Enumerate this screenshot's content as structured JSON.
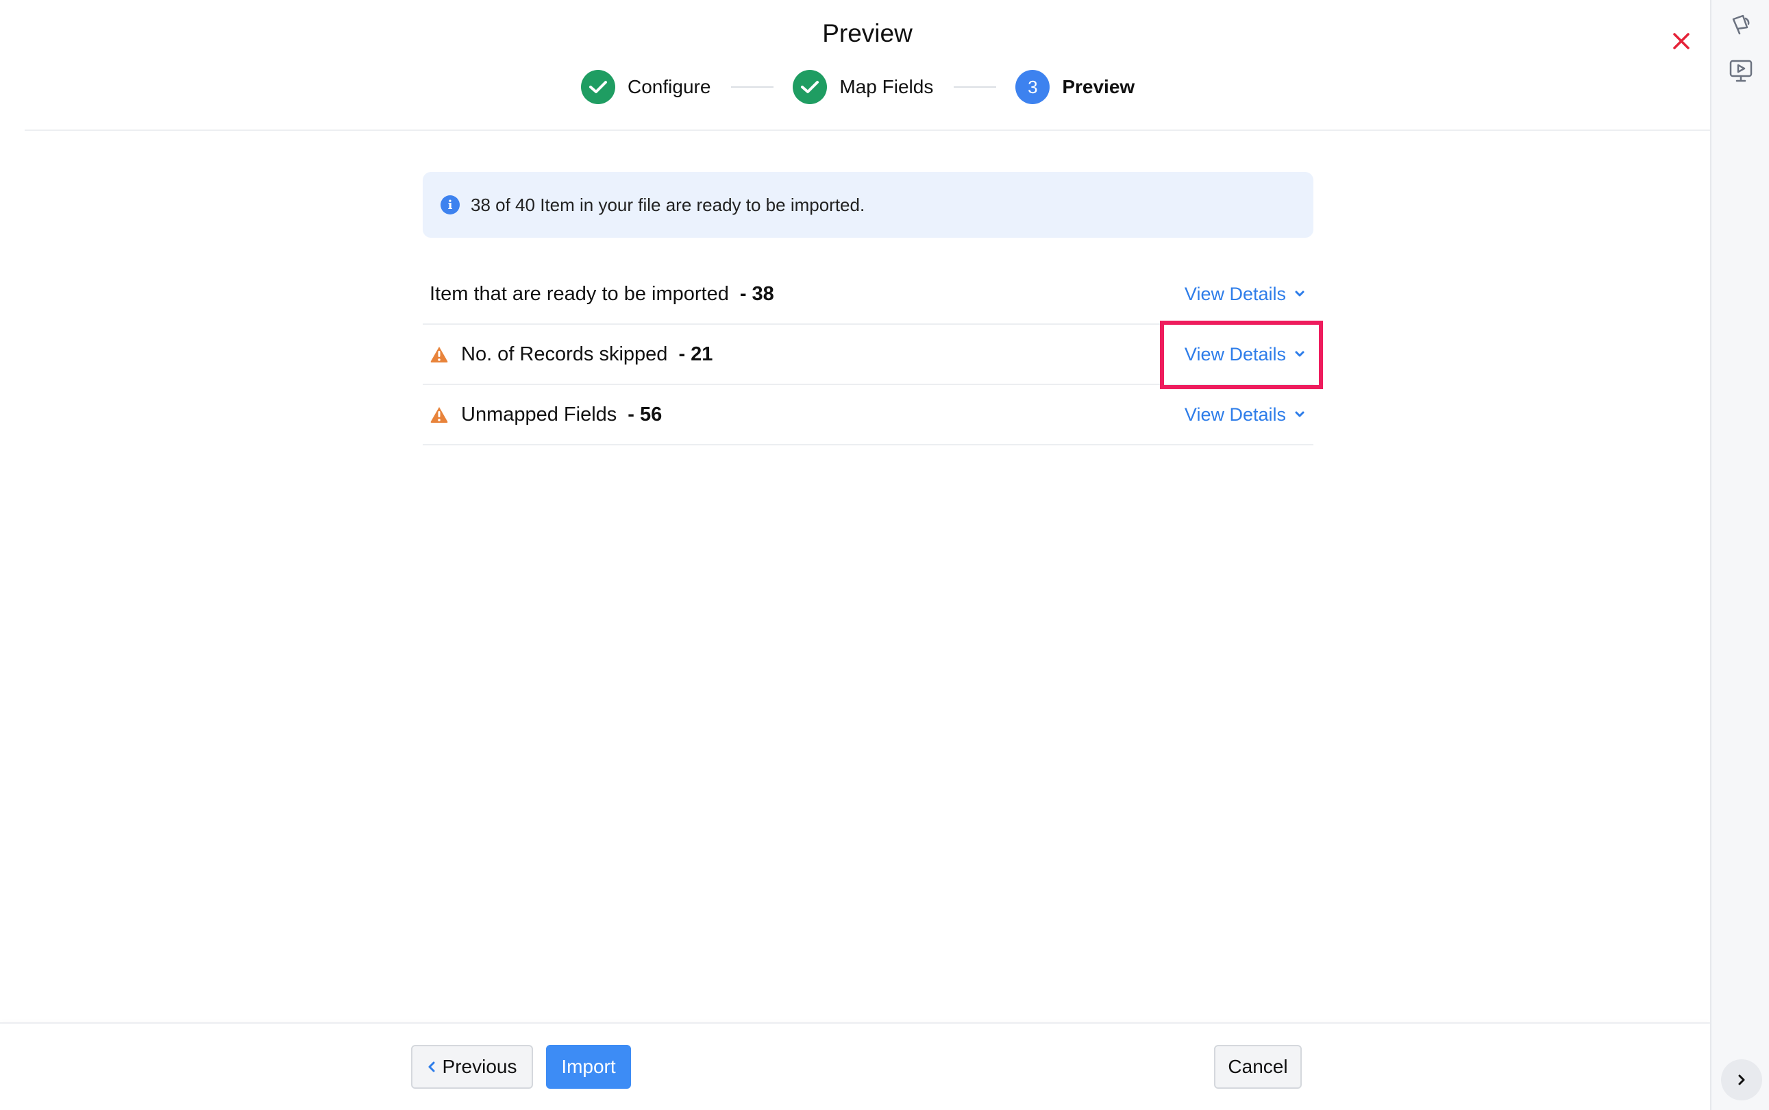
{
  "header": {
    "title": "Preview"
  },
  "stepper": {
    "steps": [
      {
        "label": "Configure",
        "state": "done"
      },
      {
        "label": "Map Fields",
        "state": "done"
      },
      {
        "label": "Preview",
        "state": "active",
        "number": "3"
      }
    ]
  },
  "info_banner": {
    "text": "38 of 40 Item in your file are ready to be imported."
  },
  "summary_rows": [
    {
      "label": "Item that are ready to be imported",
      "count": "- 38",
      "action": "View Details",
      "warning": false
    },
    {
      "label": "No. of Records skipped",
      "count": "- 21",
      "action": "View Details",
      "warning": true
    },
    {
      "label": "Unmapped Fields",
      "count": "- 56",
      "action": "View Details",
      "warning": true
    }
  ],
  "footer": {
    "previous_label": "Previous",
    "import_label": "Import",
    "cancel_label": "Cancel"
  },
  "colors": {
    "accent": "#3d82ef",
    "success": "#1f9d62",
    "warning": "#e8833a",
    "link": "#2e7de9",
    "highlight": "#ee1c5d",
    "close": "#e52238"
  },
  "icons": {
    "close": "close-icon",
    "rail_top": "megaphone-icon",
    "rail_second": "presentation-play-icon",
    "rail_bottom": "chevron-right-icon"
  }
}
